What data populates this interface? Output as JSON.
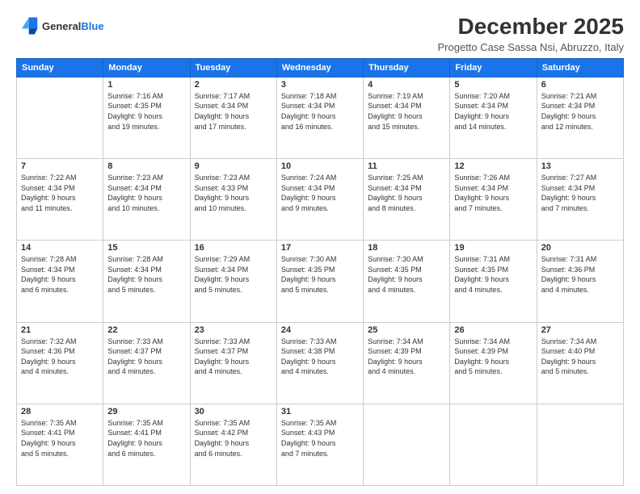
{
  "header": {
    "logo_line1": "General",
    "logo_line2": "Blue",
    "month_title": "December 2025",
    "subtitle": "Progetto Case Sassa Nsi, Abruzzo, Italy"
  },
  "days_of_week": [
    "Sunday",
    "Monday",
    "Tuesday",
    "Wednesday",
    "Thursday",
    "Friday",
    "Saturday"
  ],
  "weeks": [
    [
      {
        "day": "",
        "info": ""
      },
      {
        "day": "1",
        "info": "Sunrise: 7:16 AM\nSunset: 4:35 PM\nDaylight: 9 hours\nand 19 minutes."
      },
      {
        "day": "2",
        "info": "Sunrise: 7:17 AM\nSunset: 4:34 PM\nDaylight: 9 hours\nand 17 minutes."
      },
      {
        "day": "3",
        "info": "Sunrise: 7:18 AM\nSunset: 4:34 PM\nDaylight: 9 hours\nand 16 minutes."
      },
      {
        "day": "4",
        "info": "Sunrise: 7:19 AM\nSunset: 4:34 PM\nDaylight: 9 hours\nand 15 minutes."
      },
      {
        "day": "5",
        "info": "Sunrise: 7:20 AM\nSunset: 4:34 PM\nDaylight: 9 hours\nand 14 minutes."
      },
      {
        "day": "6",
        "info": "Sunrise: 7:21 AM\nSunset: 4:34 PM\nDaylight: 9 hours\nand 12 minutes."
      }
    ],
    [
      {
        "day": "7",
        "info": "Sunrise: 7:22 AM\nSunset: 4:34 PM\nDaylight: 9 hours\nand 11 minutes."
      },
      {
        "day": "8",
        "info": "Sunrise: 7:23 AM\nSunset: 4:34 PM\nDaylight: 9 hours\nand 10 minutes."
      },
      {
        "day": "9",
        "info": "Sunrise: 7:23 AM\nSunset: 4:33 PM\nDaylight: 9 hours\nand 10 minutes."
      },
      {
        "day": "10",
        "info": "Sunrise: 7:24 AM\nSunset: 4:34 PM\nDaylight: 9 hours\nand 9 minutes."
      },
      {
        "day": "11",
        "info": "Sunrise: 7:25 AM\nSunset: 4:34 PM\nDaylight: 9 hours\nand 8 minutes."
      },
      {
        "day": "12",
        "info": "Sunrise: 7:26 AM\nSunset: 4:34 PM\nDaylight: 9 hours\nand 7 minutes."
      },
      {
        "day": "13",
        "info": "Sunrise: 7:27 AM\nSunset: 4:34 PM\nDaylight: 9 hours\nand 7 minutes."
      }
    ],
    [
      {
        "day": "14",
        "info": "Sunrise: 7:28 AM\nSunset: 4:34 PM\nDaylight: 9 hours\nand 6 minutes."
      },
      {
        "day": "15",
        "info": "Sunrise: 7:28 AM\nSunset: 4:34 PM\nDaylight: 9 hours\nand 5 minutes."
      },
      {
        "day": "16",
        "info": "Sunrise: 7:29 AM\nSunset: 4:34 PM\nDaylight: 9 hours\nand 5 minutes."
      },
      {
        "day": "17",
        "info": "Sunrise: 7:30 AM\nSunset: 4:35 PM\nDaylight: 9 hours\nand 5 minutes."
      },
      {
        "day": "18",
        "info": "Sunrise: 7:30 AM\nSunset: 4:35 PM\nDaylight: 9 hours\nand 4 minutes."
      },
      {
        "day": "19",
        "info": "Sunrise: 7:31 AM\nSunset: 4:35 PM\nDaylight: 9 hours\nand 4 minutes."
      },
      {
        "day": "20",
        "info": "Sunrise: 7:31 AM\nSunset: 4:36 PM\nDaylight: 9 hours\nand 4 minutes."
      }
    ],
    [
      {
        "day": "21",
        "info": "Sunrise: 7:32 AM\nSunset: 4:36 PM\nDaylight: 9 hours\nand 4 minutes."
      },
      {
        "day": "22",
        "info": "Sunrise: 7:33 AM\nSunset: 4:37 PM\nDaylight: 9 hours\nand 4 minutes."
      },
      {
        "day": "23",
        "info": "Sunrise: 7:33 AM\nSunset: 4:37 PM\nDaylight: 9 hours\nand 4 minutes."
      },
      {
        "day": "24",
        "info": "Sunrise: 7:33 AM\nSunset: 4:38 PM\nDaylight: 9 hours\nand 4 minutes."
      },
      {
        "day": "25",
        "info": "Sunrise: 7:34 AM\nSunset: 4:39 PM\nDaylight: 9 hours\nand 4 minutes."
      },
      {
        "day": "26",
        "info": "Sunrise: 7:34 AM\nSunset: 4:39 PM\nDaylight: 9 hours\nand 5 minutes."
      },
      {
        "day": "27",
        "info": "Sunrise: 7:34 AM\nSunset: 4:40 PM\nDaylight: 9 hours\nand 5 minutes."
      }
    ],
    [
      {
        "day": "28",
        "info": "Sunrise: 7:35 AM\nSunset: 4:41 PM\nDaylight: 9 hours\nand 5 minutes."
      },
      {
        "day": "29",
        "info": "Sunrise: 7:35 AM\nSunset: 4:41 PM\nDaylight: 9 hours\nand 6 minutes."
      },
      {
        "day": "30",
        "info": "Sunrise: 7:35 AM\nSunset: 4:42 PM\nDaylight: 9 hours\nand 6 minutes."
      },
      {
        "day": "31",
        "info": "Sunrise: 7:35 AM\nSunset: 4:43 PM\nDaylight: 9 hours\nand 7 minutes."
      },
      {
        "day": "",
        "info": ""
      },
      {
        "day": "",
        "info": ""
      },
      {
        "day": "",
        "info": ""
      }
    ]
  ]
}
